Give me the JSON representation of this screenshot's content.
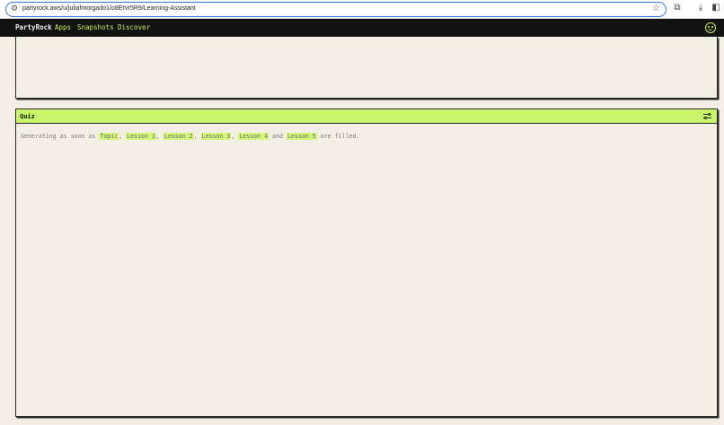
{
  "browser": {
    "url": "partyrock.aws/u/juliafmorgado1/o8EtVr5R9/Learning-Assistant",
    "icons": [
      "site-settings-icon",
      "star-icon",
      "extensions-icon",
      "download-icon",
      "sidebar-icon"
    ]
  },
  "nav": {
    "brand": "PartyRock",
    "links": [
      "Apps",
      "Snapshots",
      "Discover"
    ],
    "accent_color": "#c5f25a"
  },
  "quiz": {
    "title": "Quiz",
    "generating_prefix": "Generating as soon as ",
    "inputs": [
      "Topic",
      "Lesson 1",
      "Lesson 2",
      "Lesson 3",
      "Lesson 4",
      "Lesson 5"
    ],
    "separators": [
      ", ",
      ", ",
      ", ",
      ", ",
      " and "
    ],
    "generating_suffix": " are filled.",
    "header_color": "#c8f56a"
  }
}
